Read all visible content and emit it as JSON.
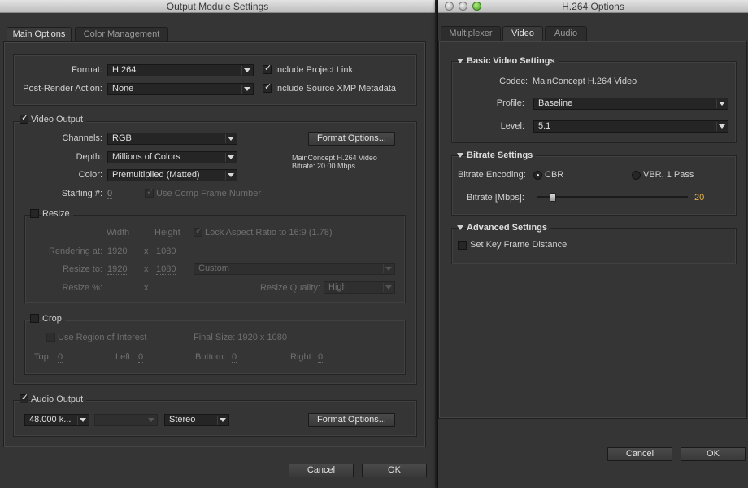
{
  "output_module": {
    "title": "Output Module Settings",
    "tabs": [
      "Main Options",
      "Color Management"
    ],
    "format_label": "Format:",
    "format_value": "H.264",
    "post_render_label": "Post-Render Action:",
    "post_render_value": "None",
    "include_project_link": "Include Project Link",
    "include_xmp": "Include Source XMP Metadata",
    "video_output": "Video Output",
    "channels_label": "Channels:",
    "channels_value": "RGB",
    "depth_label": "Depth:",
    "depth_value": "Millions of Colors",
    "color_label": "Color:",
    "color_value": "Premultiplied (Matted)",
    "format_options": "Format Options...",
    "codec_info_1": "MainConcept H.264 Video",
    "codec_info_2": "Bitrate: 20.00 Mbps",
    "starting_label": "Starting #:",
    "starting_value": "0",
    "use_comp_frame": "Use Comp Frame Number",
    "resize": {
      "label": "Resize",
      "width_label": "Width",
      "height_label": "Height",
      "lock_aspect": "Lock Aspect Ratio to 16:9 (1.78)",
      "rendering_at_label": "Rendering at:",
      "rendering_w": "1920",
      "rendering_h": "1080",
      "resize_to_label": "Resize to:",
      "resize_to_w": "1920",
      "resize_to_h": "1080",
      "preset": "Custom",
      "resize_pct_label": "Resize %:",
      "x": "x",
      "quality_label": "Resize Quality:",
      "quality_value": "High"
    },
    "crop": {
      "label": "Crop",
      "use_roi": "Use Region of Interest",
      "final_size": "Final Size: 1920 x 1080",
      "top_label": "Top:",
      "top": "0",
      "left_label": "Left:",
      "left": "0",
      "bottom_label": "Bottom:",
      "bottom": "0",
      "right_label": "Right:",
      "right": "0"
    },
    "audio_output": "Audio Output",
    "audio_rate": "48.000 k...",
    "audio_channels": "Stereo",
    "audio_format_options": "Format Options...",
    "cancel": "Cancel",
    "ok": "OK"
  },
  "h264": {
    "title": "H.264 Options",
    "tabs": [
      "Multiplexer",
      "Video",
      "Audio"
    ],
    "basic_title": "Basic Video Settings",
    "codec_label": "Codec:",
    "codec_value": "MainConcept H.264 Video",
    "profile_label": "Profile:",
    "profile_value": "Baseline",
    "level_label": "Level:",
    "level_value": "5.1",
    "bitrate_title": "Bitrate Settings",
    "encoding_label": "Bitrate Encoding:",
    "cbr": "CBR",
    "vbr": "VBR, 1 Pass",
    "bitrate_label": "Bitrate [Mbps]:",
    "bitrate_value": "20",
    "bitrate_level": 0.09,
    "advanced_title": "Advanced Settings",
    "keyframe": "Set Key Frame Distance",
    "cancel": "Cancel",
    "ok": "OK"
  }
}
